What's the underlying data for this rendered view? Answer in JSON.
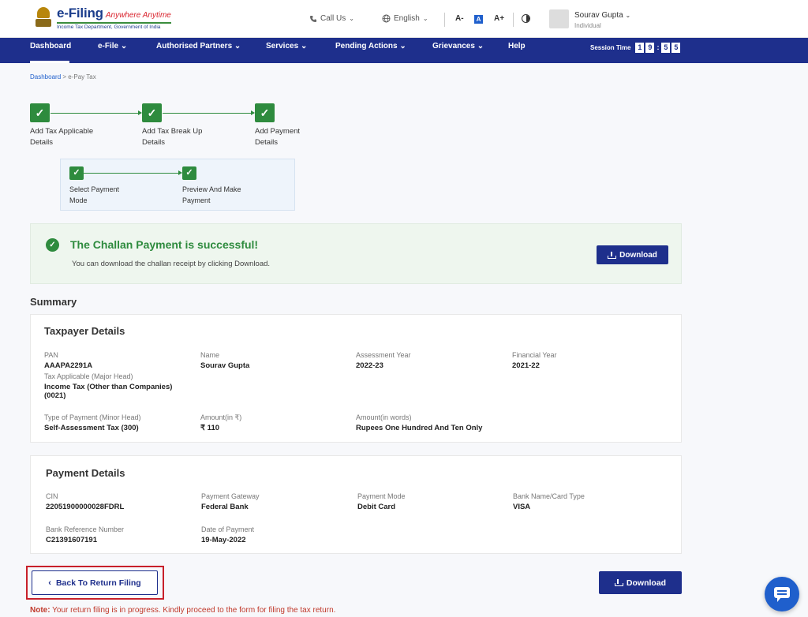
{
  "header": {
    "brand": "e-Filing",
    "tagline": "Anywhere Anytime",
    "subtitle": "Income Tax Department, Government of India",
    "call_us": "Call Us",
    "language": "English",
    "font_decrease": "A-",
    "font_normal": "A",
    "font_increase": "A+",
    "user_name": "Sourav Gupta",
    "user_role": "Individual"
  },
  "nav": {
    "items": [
      "Dashboard",
      "e-File",
      "Authorised Partners",
      "Services",
      "Pending Actions",
      "Grievances",
      "Help"
    ],
    "session_label": "Session Time",
    "session_digits": [
      "1",
      "9",
      ":",
      "5",
      "5"
    ]
  },
  "breadcrumb": {
    "root": "Dashboard",
    "separator": ">",
    "current": "e-Pay Tax"
  },
  "stepper": {
    "steps": [
      {
        "line1": "Add Tax Applicable",
        "line2": "Details"
      },
      {
        "line1": "Add Tax Break Up",
        "line2": "Details"
      },
      {
        "line1": "Add Payment",
        "line2": "Details"
      }
    ],
    "substeps": [
      {
        "line1": "Select Payment",
        "line2": "Mode"
      },
      {
        "line1": "Preview And Make",
        "line2": "Payment"
      }
    ]
  },
  "success": {
    "title": "The Challan Payment is successful!",
    "message": "You can download the challan receipt by clicking Download.",
    "download_label": "Download"
  },
  "summary": {
    "heading": "Summary",
    "taxpayer": {
      "title": "Taxpayer Details",
      "pan_label": "PAN",
      "pan": "AAAPA2291A",
      "name_label": "Name",
      "name": "Sourav Gupta",
      "ay_label": "Assessment Year",
      "ay": "2022-23",
      "fy_label": "Financial Year",
      "fy": "2021-22",
      "major_head_label": "Tax Applicable (Major Head)",
      "major_head_line1": "Income Tax (Other than Companies)",
      "major_head_line2": "(0021)",
      "minor_head_label": "Type of Payment (Minor Head)",
      "minor_head": "Self-Assessment Tax (300)",
      "amount_label": "Amount(in ₹)",
      "amount": "₹ 110",
      "amount_words_label": "Amount(in words)",
      "amount_words": "Rupees One Hundred And Ten Only"
    },
    "payment": {
      "title": "Payment Details",
      "cin_label": "CIN",
      "cin": "22051900000028FDRL",
      "gateway_label": "Payment Gateway",
      "gateway": "Federal Bank",
      "mode_label": "Payment Mode",
      "mode": "Debit Card",
      "bank_label": "Bank Name/Card Type",
      "bank": "VISA",
      "ref_label": "Bank Reference Number",
      "ref": "C21391607191",
      "date_label": "Date of Payment",
      "date": "19-May-2022"
    }
  },
  "actions": {
    "back_label": "Back To Return Filing",
    "download_label": "Download"
  },
  "note": {
    "prefix": "Note:",
    "text": " Your return filing is in progress. Kindly proceed to the form for filing the tax return."
  },
  "colors": {
    "nav_bg": "#1e2f8c",
    "success_green": "#2e8b3e",
    "highlight_red": "#c8202a",
    "chat_blue": "#1f5fcc"
  }
}
